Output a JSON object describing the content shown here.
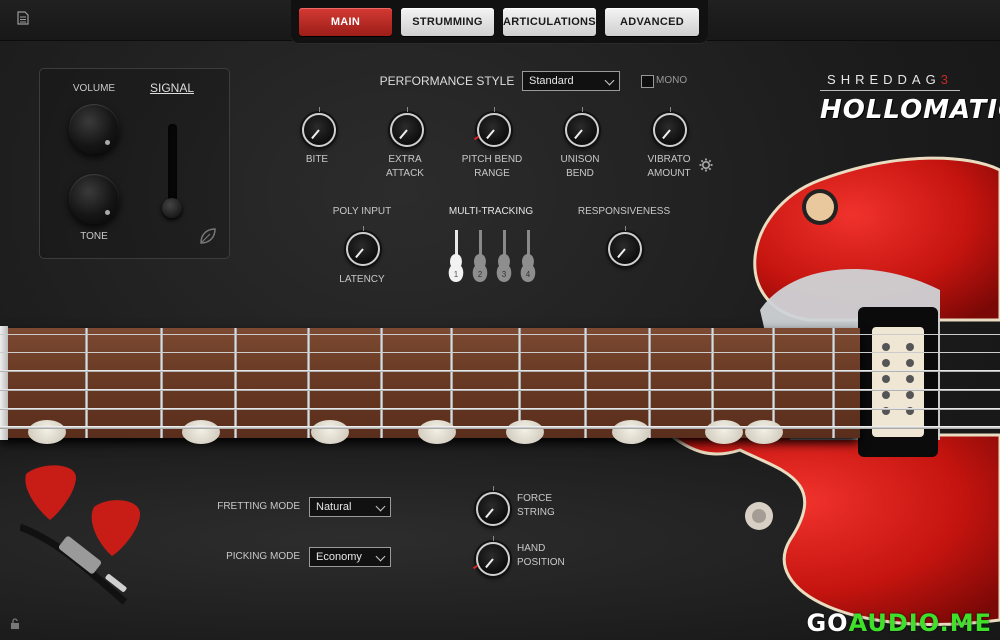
{
  "tabs": [
    {
      "label": "MAIN",
      "active": true
    },
    {
      "label": "STRUMMING",
      "active": false
    },
    {
      "label": "ARTICULATIONS",
      "active": false
    },
    {
      "label": "ADVANCED",
      "active": false
    }
  ],
  "signal": {
    "title": "SIGNAL",
    "volume_label": "VOLUME",
    "tone_label": "TONE"
  },
  "performance": {
    "style_label": "PERFORMANCE STYLE",
    "style_value": "Standard",
    "mono_label": "MONO",
    "mono_checked": false
  },
  "knobs": {
    "bite": "BITE",
    "extra_attack": [
      "EXTRA",
      "ATTACK"
    ],
    "pitch_bend_range": [
      "PITCH BEND",
      "RANGE"
    ],
    "unison_bend": [
      "UNISON",
      "BEND"
    ],
    "vibrato_amount": [
      "VIBRATO",
      "AMOUNT"
    ],
    "poly_input": "POLY INPUT",
    "latency": "LATENCY",
    "multi_tracking": "MULTI-TRACKING",
    "responsiveness": "RESPONSIVENESS"
  },
  "multitrack_guitars": [
    "1",
    "2",
    "3",
    "4"
  ],
  "logo": {
    "line1": "SHREDDAG",
    "line1_suffix": "3",
    "line2": "HOLLOMATIC"
  },
  "bottom": {
    "fretting_label": "FRETTING MODE",
    "fretting_value": "Natural",
    "picking_label": "PICKING MODE",
    "picking_value": "Economy",
    "force_string": [
      "FORCE",
      "STRING"
    ],
    "hand_position": [
      "HAND",
      "POSITION"
    ]
  },
  "watermark": {
    "part1": "GO",
    "part2": "AUDIO.ME"
  },
  "colors": {
    "accent_red": "#c42a24",
    "guitar_red": "#d31c1c",
    "watermark_green": "#3fe029"
  }
}
